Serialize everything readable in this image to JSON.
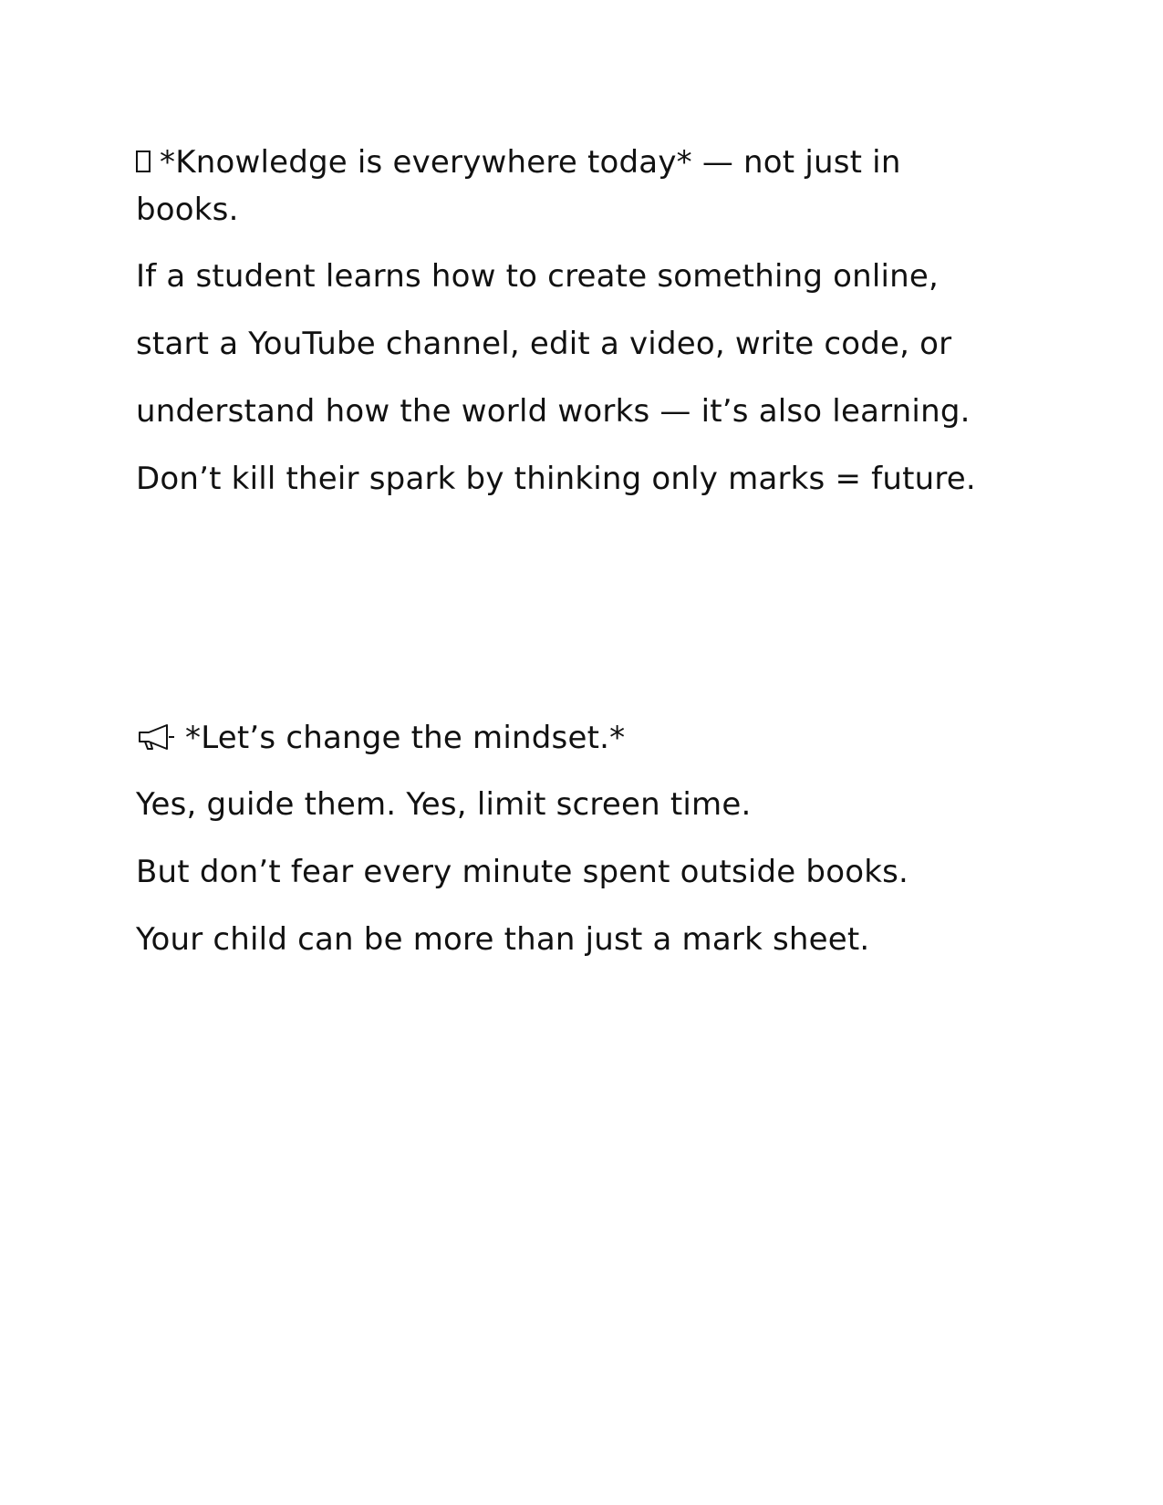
{
  "section1": {
    "icon": "missing-glyph-box-icon",
    "lines": [
      "*Knowledge is everywhere today* — not just in",
      "books.",
      "If a student learns how to create something online,",
      "start a YouTube channel, edit a video, write code, or",
      "understand how the world works — it’s also learning.",
      "Don’t kill their spark by thinking only marks = future."
    ]
  },
  "section2": {
    "icon": "megaphone-icon",
    "lines": [
      "*Let’s change the mindset.*",
      "Yes, guide them. Yes, limit screen time.",
      "But don’t fear every minute spent outside books.",
      "Your child can be more than just a mark sheet."
    ]
  }
}
